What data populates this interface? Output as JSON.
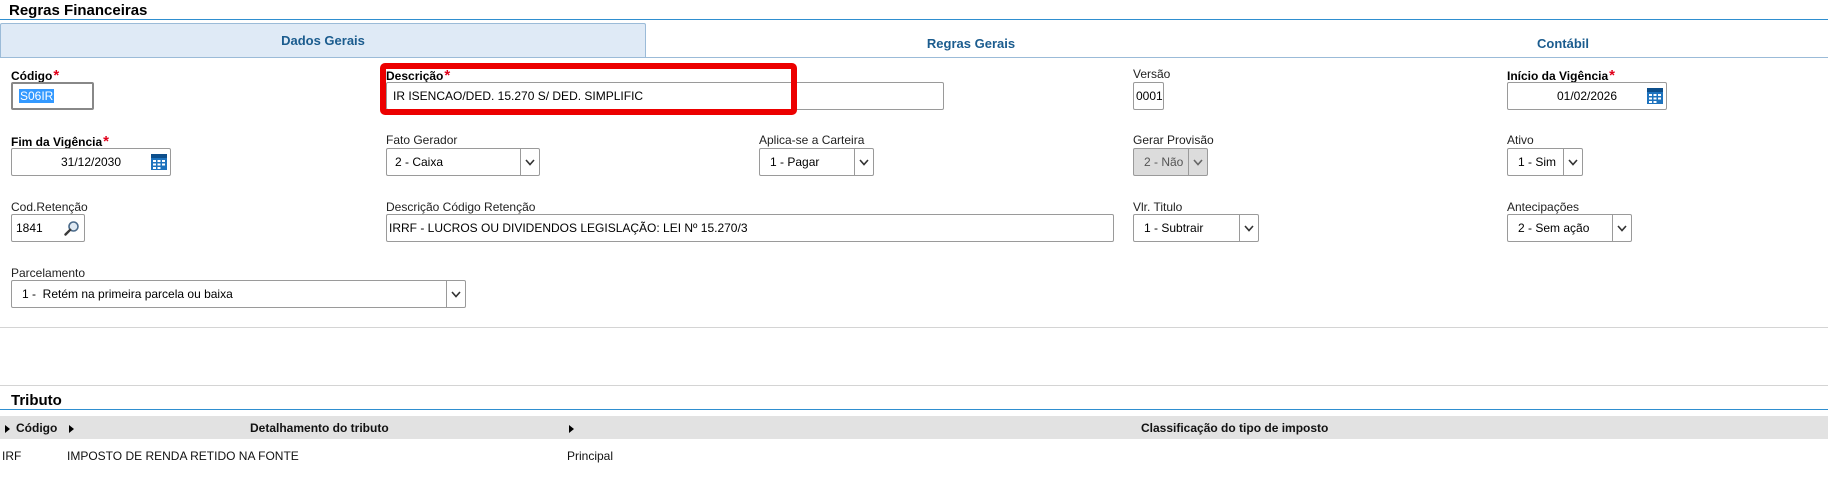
{
  "header": {
    "title": "Regras Financeiras"
  },
  "tabs": [
    {
      "label": "Dados Gerais",
      "active": true
    },
    {
      "label": "Regras Gerais",
      "active": false
    },
    {
      "label": "Contábil",
      "active": false
    }
  ],
  "form": {
    "codigo": {
      "label": "Código",
      "required": true,
      "value": "S06IR"
    },
    "descricao": {
      "label": "Descrição",
      "required": true,
      "value": "IR ISENCAO/DED. 15.270 S/ DED. SIMPLIFIC"
    },
    "versao": {
      "label": "Versão",
      "value": "0001"
    },
    "inicio_vigencia": {
      "label": "Início da Vigência",
      "required": true,
      "value": "01/02/2026"
    },
    "fim_vigencia": {
      "label": "Fim da Vigência",
      "required": true,
      "value": "31/12/2030"
    },
    "fato_gerador": {
      "label": "Fato Gerador",
      "value": "2 - Caixa"
    },
    "aplica_carteira": {
      "label": "Aplica-se a Carteira",
      "value": "1 - Pagar"
    },
    "gerar_provisao": {
      "label": "Gerar Provisão",
      "value": "2 - Não",
      "disabled": true
    },
    "ativo": {
      "label": "Ativo",
      "value": "1 - Sim"
    },
    "cod_retencao": {
      "label": "Cod.Retenção",
      "value": "1841"
    },
    "desc_cod_retencao": {
      "label": "Descrição Código Retenção",
      "value": "IRRF - LUCROS OU DIVIDENDOS LEGISLAÇÃO: LEI Nº 15.270/3"
    },
    "vlr_titulo": {
      "label": "Vlr. Titulo",
      "value": "1 - Subtrair"
    },
    "antecipacoes": {
      "label": "Antecipações",
      "value": "2 - Sem ação"
    },
    "parcelamento": {
      "label": "Parcelamento",
      "value": "1 -  Retém na primeira parcela ou baixa"
    }
  },
  "tributo": {
    "title": "Tributo",
    "columns": [
      "Código",
      "Detalhamento do tributo",
      "Classificação do tipo de imposto"
    ],
    "rows": [
      [
        "IRF",
        "IMPOSTO DE RENDA RETIDO NA FONTE",
        "Principal"
      ]
    ]
  },
  "colors": {
    "accent_line": "#2f8fd0",
    "tab_text": "#1b5c8e",
    "required_star": "#e0001a",
    "highlight_box": "#ec0000",
    "selection": "#3399ff"
  },
  "icons": [
    "calendar-icon",
    "search-icon",
    "chevron-down-icon"
  ]
}
